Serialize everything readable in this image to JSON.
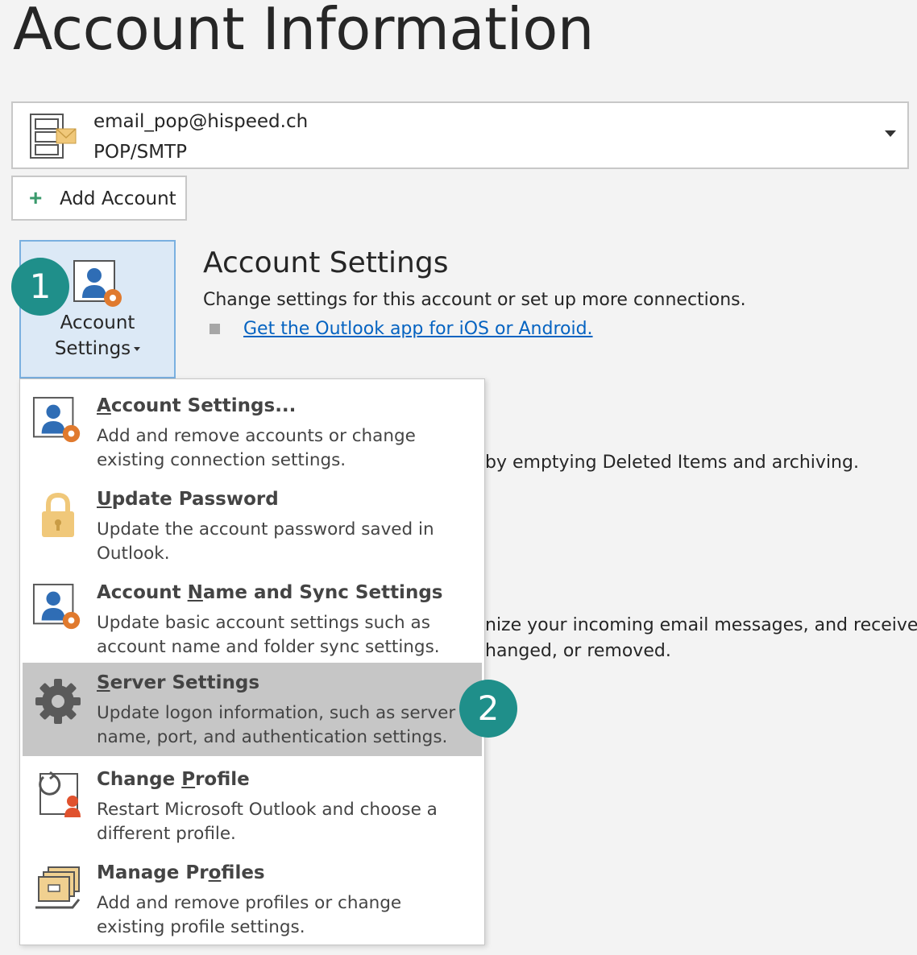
{
  "page": {
    "title": "Account Information"
  },
  "account": {
    "email": "email_pop@hispeed.ch",
    "type": "POP/SMTP"
  },
  "add_account": {
    "label": "Add Account"
  },
  "settings_button": {
    "line1": "Account",
    "line2": "Settings"
  },
  "badges": {
    "step1": "1",
    "step2": "2"
  },
  "account_settings_section": {
    "title": "Account Settings",
    "description": "Change settings for this account or set up more connections.",
    "link": "Get the Outlook app for iOS or Android."
  },
  "background_text": {
    "line1": "by emptying Deleted Items and archiving.",
    "line2": "nize your incoming email messages, and receive",
    "line3": "hanged, or removed."
  },
  "menu": {
    "items": [
      {
        "title_pre": "",
        "title_ul": "A",
        "title_post": "ccount Settings...",
        "desc": "Add and remove accounts or change existing connection settings.",
        "icon": "account-settings-icon"
      },
      {
        "title_pre": "",
        "title_ul": "U",
        "title_post": "pdate Password",
        "desc": "Update the account password saved in Outlook.",
        "icon": "lock-icon"
      },
      {
        "title_pre": "Account ",
        "title_ul": "N",
        "title_post": "ame and Sync Settings",
        "desc": "Update basic account settings such as account name and folder sync settings.",
        "icon": "account-settings-icon"
      },
      {
        "title_pre": "",
        "title_ul": "S",
        "title_post": "erver Settings",
        "desc": "Update logon information, such as server name, port, and authentication settings.",
        "icon": "gear-icon"
      },
      {
        "title_pre": "Change ",
        "title_ul": "P",
        "title_post": "rofile",
        "desc": "Restart Microsoft Outlook and choose a different profile.",
        "icon": "change-profile-icon"
      },
      {
        "title_pre": "Manage Pr",
        "title_ul": "o",
        "title_post": "files",
        "desc": "Add and remove profiles or change existing profile settings.",
        "icon": "manage-profiles-icon"
      }
    ]
  },
  "colors": {
    "badge": "#1f8f8a",
    "link": "#0563c1",
    "selected_button_bg": "#dce9f6",
    "hover_item_bg": "#c6c6c6"
  }
}
